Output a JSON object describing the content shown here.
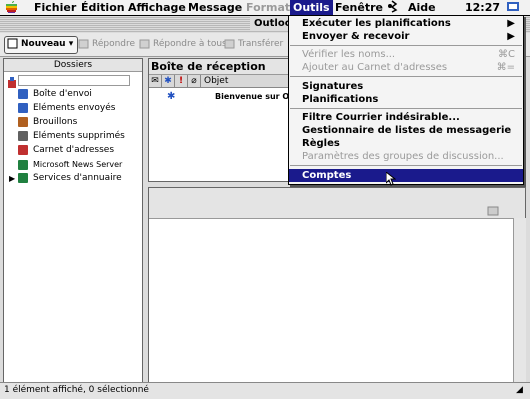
{
  "menubar": {
    "apple_icon": "apple-logo",
    "items": [
      "Fichier",
      "Édition",
      "Affichage",
      "Message",
      "Format",
      "Outils",
      "Fenêtre",
      "Aide"
    ],
    "clock": "12:27"
  },
  "window": {
    "title": "Outlook Expr"
  },
  "toolbar": {
    "new_label": "Nouveau",
    "reply_label": "Répondre",
    "reply_all_label": "Répondre à tous",
    "forward_label": "Transférer"
  },
  "folders": {
    "header": "Dossiers",
    "items": [
      {
        "label": "Boîte d'envoi",
        "icon": "outbox-icon",
        "color": "#3060c0"
      },
      {
        "label": "Eléments envoyés",
        "icon": "sent-icon",
        "color": "#3060c0"
      },
      {
        "label": "Brouillons",
        "icon": "drafts-icon",
        "color": "#b06020"
      },
      {
        "label": "Eléments supprimés",
        "icon": "trash-icon",
        "color": "#606060"
      },
      {
        "label": "Carnet d'adresses",
        "icon": "address-book-icon",
        "color": "#c03030"
      },
      {
        "label": "Microsoft News Server",
        "icon": "news-server-icon",
        "color": "#208040"
      },
      {
        "label": "Services d'annuaire",
        "icon": "directory-icon",
        "color": "#208040"
      }
    ]
  },
  "inbox": {
    "title": "Boîte de réception",
    "column_subject": "Objet",
    "message_subject": "Bienvenue sur Ou"
  },
  "status": {
    "text": "1 élément affiché, 0 sélectionné"
  },
  "tools_menu": {
    "items": [
      {
        "label": "Exécuter les planifications",
        "shortcut": "▶",
        "state": "normal"
      },
      {
        "label": "Envoyer & recevoir",
        "shortcut": "▶",
        "state": "normal"
      },
      {
        "label": "Vérifier les noms...",
        "shortcut": "⌘C",
        "state": "dim"
      },
      {
        "label": "Ajouter au Carnet d'adresses",
        "shortcut": "⌘=",
        "state": "dim"
      },
      {
        "label": "Signatures",
        "shortcut": "",
        "state": "normal"
      },
      {
        "label": "Planifications",
        "shortcut": "",
        "state": "normal"
      },
      {
        "label": "Filtre Courrier indésirable...",
        "shortcut": "",
        "state": "normal"
      },
      {
        "label": "Gestionnaire de listes de messagerie",
        "shortcut": "",
        "state": "normal"
      },
      {
        "label": "Règles",
        "shortcut": "",
        "state": "normal"
      },
      {
        "label": "Paramètres des groupes de discussion...",
        "shortcut": "",
        "state": "dim"
      },
      {
        "label": "Comptes",
        "shortcut": "",
        "state": "selected"
      }
    ]
  },
  "colors": {
    "menu_highlight": "#1a1a8c"
  }
}
